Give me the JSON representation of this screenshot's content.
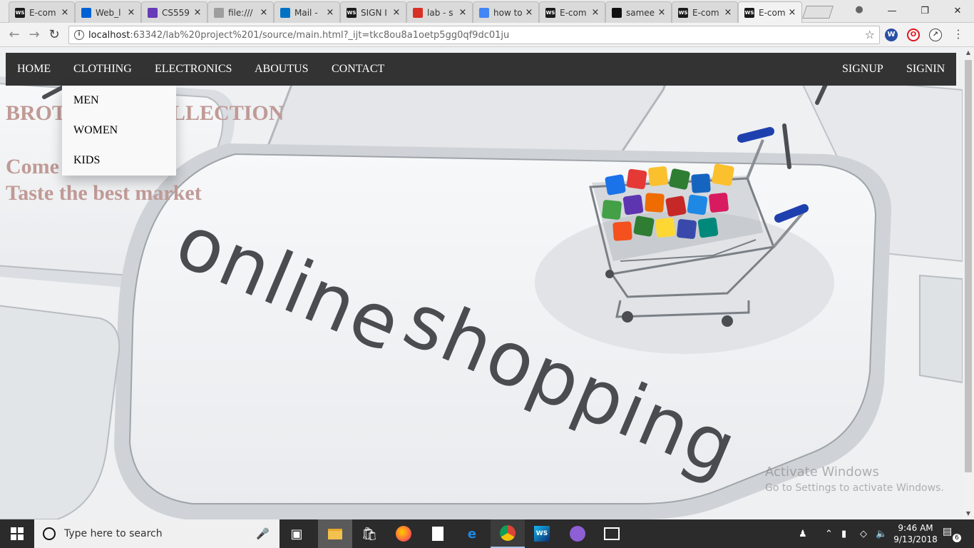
{
  "browser": {
    "tabs": [
      {
        "title": "E-com",
        "favicon": "webstorm-icon",
        "color": "#1b1b1b",
        "active": false
      },
      {
        "title": "Web_l",
        "favicon": "box-icon",
        "color": "#0061d5",
        "active": false
      },
      {
        "title": "CS559",
        "favicon": "forms-icon",
        "color": "#673ab7",
        "active": false
      },
      {
        "title": "file:///",
        "favicon": "file-icon",
        "color": "#9e9e9e",
        "active": false
      },
      {
        "title": "Mail -",
        "favicon": "outlook-icon",
        "color": "#0072c6",
        "active": false
      },
      {
        "title": "SIGN I",
        "favicon": "webstorm-icon",
        "color": "#1b1b1b",
        "active": false
      },
      {
        "title": "lab - s",
        "favicon": "gmail-icon",
        "color": "#d93025",
        "active": false
      },
      {
        "title": "how to",
        "favicon": "google-icon",
        "color": "#4285f4",
        "active": false
      },
      {
        "title": "E-com",
        "favicon": "webstorm-icon",
        "color": "#1b1b1b",
        "active": false
      },
      {
        "title": "samee",
        "favicon": "github-icon",
        "color": "#111111",
        "active": false
      },
      {
        "title": "E-com",
        "favicon": "webstorm-icon",
        "color": "#1b1b1b",
        "active": false
      },
      {
        "title": "E-com",
        "favicon": "webstorm-icon",
        "color": "#1b1b1b",
        "active": true
      }
    ],
    "url_host": "localhost",
    "url_rest": ":63342/lab%20project%201/source/main.html?_ijt=tkc8ou8a1oetp5gg0qf9dc01ju"
  },
  "page": {
    "nav": {
      "home": "HOME",
      "clothing": "CLOTHING",
      "electronics": "ELECTRONICS",
      "aboutus": "ABOUTUS",
      "contact": "CONTACT",
      "signup": "SIGNUP",
      "signin": "SIGNIN"
    },
    "dropdown": {
      "men": "MEN",
      "women": "WOMEN",
      "kids": "KIDS"
    },
    "hero": {
      "heading_left": "BROT",
      "heading_right": "LLECTION",
      "line1": "Come",
      "line2": "Taste the best market",
      "image_text": "online shopping"
    },
    "watermark": {
      "title": "Activate Windows",
      "subtitle": "Go to Settings to activate Windows."
    }
  },
  "taskbar": {
    "search_placeholder": "Type here to search",
    "time": "9:46 AM",
    "date": "9/13/2018",
    "notification_count": "6"
  }
}
